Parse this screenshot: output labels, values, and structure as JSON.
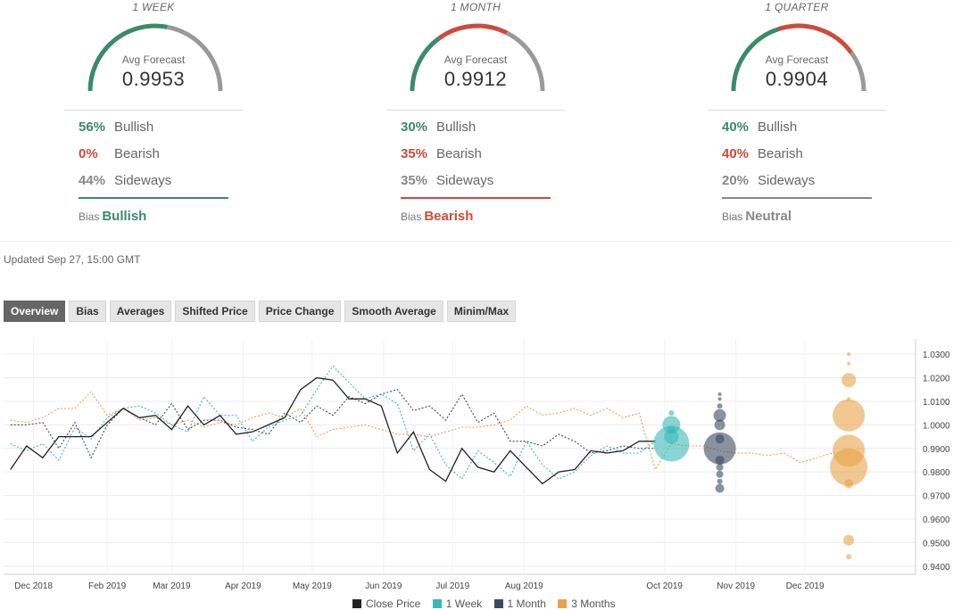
{
  "forecasts": [
    {
      "period": "1 WEEK",
      "avg_label": "Avg Forecast",
      "avg_value": "0.9953",
      "bullish_pct": "56%",
      "bearish_pct": "0%",
      "sideways_pct": "44%",
      "bullish_label": "Bullish",
      "bearish_label": "Bearish",
      "sideways_label": "Sideways",
      "bias_label": "Bias",
      "bias_value": "Bullish",
      "bias_color": "#3a8a6c",
      "bullish": 56,
      "bearish": 0,
      "sideways": 44
    },
    {
      "period": "1 MONTH",
      "avg_label": "Avg Forecast",
      "avg_value": "0.9912",
      "bullish_pct": "30%",
      "bearish_pct": "35%",
      "sideways_pct": "35%",
      "bullish_label": "Bullish",
      "bearish_label": "Bearish",
      "sideways_label": "Sideways",
      "bias_label": "Bias",
      "bias_value": "Bearish",
      "bias_color": "#cc4b3c",
      "bullish": 30,
      "bearish": 35,
      "sideways": 35
    },
    {
      "period": "1 QUARTER",
      "avg_label": "Avg Forecast",
      "avg_value": "0.9904",
      "bullish_pct": "40%",
      "bearish_pct": "40%",
      "sideways_pct": "20%",
      "bullish_label": "Bullish",
      "bearish_label": "Bearish",
      "sideways_label": "Sideways",
      "bias_label": "Bias",
      "bias_value": "Neutral",
      "bias_color": "#888888",
      "bullish": 40,
      "bearish": 40,
      "sideways": 20
    }
  ],
  "colors": {
    "bullish": "#3a8a6c",
    "bearish": "#cc4b3c",
    "sideways": "#999999"
  },
  "updated": "Updated Sep 27, 15:00 GMT",
  "tabs": [
    "Overview",
    "Bias",
    "Averages",
    "Shifted Price",
    "Price Change",
    "Smooth Average",
    "Minim/Max"
  ],
  "active_tab": 0,
  "chart_data": {
    "type": "line",
    "x_ticks": [
      "Dec 2018",
      "Feb 2019",
      "Mar 2019",
      "Apr 2019",
      "May 2019",
      "Jun 2019",
      "Jul 2019",
      "Aug 2019",
      "Oct 2019",
      "Nov 2019",
      "Dec 2019"
    ],
    "y_ticks": [
      "1.0300",
      "1.0200",
      "1.0100",
      "1.0000",
      "0.9900",
      "0.9800",
      "0.9700",
      "0.9600",
      "0.9500",
      "0.9400"
    ],
    "ylim": [
      0.9365,
      1.0365
    ],
    "x_range": [
      "2018-12-18",
      "2020-01-18"
    ],
    "grid": true,
    "legend_position": "bottom",
    "series": [
      {
        "name": "Close Price",
        "color": "#222222",
        "style": "solid",
        "points": [
          [
            "2018-12-21",
            0.981
          ],
          [
            "2018-12-28",
            0.991
          ],
          [
            "2019-01-04",
            0.986
          ],
          [
            "2019-01-11",
            0.995
          ],
          [
            "2019-01-18",
            0.995
          ],
          [
            "2019-01-25",
            0.995
          ],
          [
            "2019-02-01",
            1.001
          ],
          [
            "2019-02-08",
            1.007
          ],
          [
            "2019-02-15",
            1.003
          ],
          [
            "2019-02-22",
            1.004
          ],
          [
            "2019-03-01",
            0.998
          ],
          [
            "2019-03-08",
            1.008
          ],
          [
            "2019-03-15",
            1.0
          ],
          [
            "2019-03-22",
            1.004
          ],
          [
            "2019-03-29",
            0.996
          ],
          [
            "2019-04-05",
            0.997
          ],
          [
            "2019-04-12",
            1.0
          ],
          [
            "2019-04-19",
            1.003
          ],
          [
            "2019-04-26",
            1.015
          ],
          [
            "2019-05-03",
            1.02
          ],
          [
            "2019-05-10",
            1.019
          ],
          [
            "2019-05-17",
            1.011
          ],
          [
            "2019-05-24",
            1.011
          ],
          [
            "2019-05-31",
            1.008
          ],
          [
            "2019-06-07",
            0.988
          ],
          [
            "2019-06-14",
            0.997
          ],
          [
            "2019-06-21",
            0.981
          ],
          [
            "2019-06-28",
            0.976
          ],
          [
            "2019-07-05",
            0.99
          ],
          [
            "2019-07-12",
            0.982
          ],
          [
            "2019-07-19",
            0.98
          ],
          [
            "2019-07-26",
            0.989
          ],
          [
            "2019-08-02",
            0.982
          ],
          [
            "2019-08-09",
            0.975
          ],
          [
            "2019-08-16",
            0.98
          ],
          [
            "2019-08-23",
            0.981
          ],
          [
            "2019-08-30",
            0.989
          ],
          [
            "2019-09-06",
            0.988
          ],
          [
            "2019-09-13",
            0.989
          ],
          [
            "2019-09-20",
            0.993
          ],
          [
            "2019-09-27",
            0.993
          ]
        ]
      },
      {
        "name": "1 Week",
        "color": "#3ab8b8",
        "style": "dotted",
        "points": [
          [
            "2018-12-21",
            0.992
          ],
          [
            "2018-12-28",
            0.989
          ],
          [
            "2019-01-04",
            0.992
          ],
          [
            "2019-01-11",
            0.985
          ],
          [
            "2019-01-18",
            0.999
          ],
          [
            "2019-01-25",
            0.994
          ],
          [
            "2019-02-01",
            1.003
          ],
          [
            "2019-02-08",
            1.007
          ],
          [
            "2019-02-15",
            1.008
          ],
          [
            "2019-02-22",
            1.005
          ],
          [
            "2019-03-01",
            1.0
          ],
          [
            "2019-03-08",
            0.997
          ],
          [
            "2019-03-15",
            1.012
          ],
          [
            "2019-03-22",
            1.004
          ],
          [
            "2019-03-29",
            1.004
          ],
          [
            "2019-04-05",
            0.993
          ],
          [
            "2019-04-12",
            0.999
          ],
          [
            "2019-04-19",
            1.002
          ],
          [
            "2019-04-26",
            1.004
          ],
          [
            "2019-05-03",
            1.015
          ],
          [
            "2019-05-10",
            1.025
          ],
          [
            "2019-05-17",
            1.018
          ],
          [
            "2019-05-24",
            1.011
          ],
          [
            "2019-05-31",
            1.013
          ],
          [
            "2019-06-07",
            1.009
          ],
          [
            "2019-06-14",
            0.989
          ],
          [
            "2019-06-21",
            0.996
          ],
          [
            "2019-06-28",
            0.983
          ],
          [
            "2019-07-05",
            0.977
          ],
          [
            "2019-07-12",
            0.989
          ],
          [
            "2019-07-19",
            0.984
          ],
          [
            "2019-07-26",
            0.978
          ],
          [
            "2019-08-02",
            0.993
          ],
          [
            "2019-08-09",
            0.983
          ],
          [
            "2019-08-16",
            0.977
          ],
          [
            "2019-08-23",
            0.98
          ],
          [
            "2019-08-30",
            0.987
          ],
          [
            "2019-09-06",
            0.991
          ],
          [
            "2019-09-13",
            0.988
          ],
          [
            "2019-09-20",
            0.988
          ],
          [
            "2019-09-27",
            0.993
          ]
        ]
      },
      {
        "name": "1 Month",
        "color": "#3a4a5e",
        "style": "dotted",
        "points": [
          [
            "2018-12-21",
            1.0
          ],
          [
            "2018-12-28",
            1.0
          ],
          [
            "2019-01-04",
            1.001
          ],
          [
            "2019-01-11",
            0.99
          ],
          [
            "2019-01-18",
            1.001
          ],
          [
            "2019-01-25",
            0.986
          ],
          [
            "2019-02-01",
            1.0
          ],
          [
            "2019-02-08",
            1.007
          ],
          [
            "2019-02-15",
            1.003
          ],
          [
            "2019-02-22",
            1.0
          ],
          [
            "2019-03-01",
            1.009
          ],
          [
            "2019-03-08",
            0.998
          ],
          [
            "2019-03-15",
            1.002
          ],
          [
            "2019-03-22",
            1.002
          ],
          [
            "2019-03-29",
            0.999
          ],
          [
            "2019-04-05",
            0.998
          ],
          [
            "2019-04-12",
            0.996
          ],
          [
            "2019-04-19",
            1.005
          ],
          [
            "2019-04-26",
            1.001
          ],
          [
            "2019-05-03",
            1.008
          ],
          [
            "2019-05-10",
            1.004
          ],
          [
            "2019-05-17",
            1.012
          ],
          [
            "2019-05-24",
            1.009
          ],
          [
            "2019-05-31",
            1.013
          ],
          [
            "2019-06-07",
            1.015
          ],
          [
            "2019-06-14",
            1.006
          ],
          [
            "2019-06-21",
            1.008
          ],
          [
            "2019-06-28",
            1.002
          ],
          [
            "2019-07-05",
            1.013
          ],
          [
            "2019-07-12",
            1.001
          ],
          [
            "2019-07-19",
            1.005
          ],
          [
            "2019-07-26",
            0.993
          ],
          [
            "2019-08-02",
            0.993
          ],
          [
            "2019-08-09",
            0.991
          ],
          [
            "2019-08-16",
            0.996
          ],
          [
            "2019-08-23",
            0.993
          ],
          [
            "2019-08-30",
            0.988
          ],
          [
            "2019-09-06",
            0.989
          ],
          [
            "2019-09-13",
            0.991
          ],
          [
            "2019-09-20",
            0.99
          ],
          [
            "2019-09-27",
            0.99
          ]
        ]
      },
      {
        "name": "3 Months",
        "color": "#e8a24a",
        "style": "dotted",
        "points": [
          [
            "2018-12-21",
            1.002
          ],
          [
            "2018-12-28",
            1.001
          ],
          [
            "2019-01-04",
            1.003
          ],
          [
            "2019-01-11",
            1.007
          ],
          [
            "2019-01-18",
            1.007
          ],
          [
            "2019-01-25",
            1.014
          ],
          [
            "2019-02-01",
            1.004
          ],
          [
            "2019-02-08",
            1.007
          ],
          [
            "2019-02-15",
            1.002
          ],
          [
            "2019-02-22",
            1.003
          ],
          [
            "2019-03-01",
            1.0
          ],
          [
            "2019-03-08",
            1.002
          ],
          [
            "2019-03-15",
            0.999
          ],
          [
            "2019-03-22",
            1.001
          ],
          [
            "2019-03-29",
            1.0
          ],
          [
            "2019-04-05",
            1.003
          ],
          [
            "2019-04-12",
            1.005
          ],
          [
            "2019-04-19",
            1.003
          ],
          [
            "2019-04-26",
            1.007
          ],
          [
            "2019-05-03",
            0.995
          ],
          [
            "2019-05-10",
            0.998
          ],
          [
            "2019-05-17",
            0.999
          ],
          [
            "2019-05-24",
            1.0
          ],
          [
            "2019-05-31",
            0.998
          ],
          [
            "2019-06-07",
            0.996
          ],
          [
            "2019-06-14",
            0.996
          ],
          [
            "2019-06-21",
            0.995
          ],
          [
            "2019-06-28",
            0.997
          ],
          [
            "2019-07-05",
            0.999
          ],
          [
            "2019-07-12",
            0.999
          ],
          [
            "2019-07-19",
            1.0
          ],
          [
            "2019-07-26",
            1.002
          ],
          [
            "2019-08-02",
            1.008
          ],
          [
            "2019-08-09",
            1.004
          ],
          [
            "2019-08-16",
            1.005
          ],
          [
            "2019-08-23",
            1.007
          ],
          [
            "2019-08-30",
            1.004
          ],
          [
            "2019-09-06",
            1.007
          ],
          [
            "2019-09-13",
            1.003
          ],
          [
            "2019-09-20",
            1.005
          ],
          [
            "2019-09-27",
            0.981
          ],
          [
            "2019-10-04",
            0.992
          ],
          [
            "2019-10-11",
            0.991
          ],
          [
            "2019-10-18",
            0.991
          ],
          [
            "2019-10-25",
            0.989
          ],
          [
            "2019-11-01",
            0.988
          ],
          [
            "2019-11-08",
            0.988
          ],
          [
            "2019-11-15",
            0.987
          ],
          [
            "2019-11-22",
            0.988
          ],
          [
            "2019-11-29",
            0.984
          ],
          [
            "2019-12-06",
            0.986
          ],
          [
            "2019-12-13",
            0.988
          ],
          [
            "2019-12-20",
            0.988
          ]
        ]
      }
    ],
    "forecast_bubbles": [
      {
        "series": "1 Week",
        "date": "2019-10-04",
        "values": [
          1.0,
          0.995,
          0.992,
          1.005,
          0.998
        ],
        "sizes": [
          10,
          8,
          20,
          3,
          4
        ]
      },
      {
        "series": "1 Month",
        "date": "2019-10-25",
        "values": [
          0.99,
          1.0,
          0.994,
          1.004,
          0.985,
          0.982,
          0.979,
          0.976,
          0.973,
          1.008,
          1.011,
          1.013
        ],
        "sizes": [
          18,
          6,
          5,
          7,
          5,
          4,
          4,
          3,
          5,
          3,
          2,
          2
        ]
      },
      {
        "series": "3 Months",
        "date": "2019-12-20",
        "values": [
          1.004,
          0.989,
          0.982,
          1.019,
          0.975,
          0.951,
          0.944,
          1.026,
          1.03,
          1.011
        ],
        "sizes": [
          18,
          18,
          21,
          8,
          5,
          6,
          3,
          2,
          2,
          2
        ]
      }
    ]
  }
}
